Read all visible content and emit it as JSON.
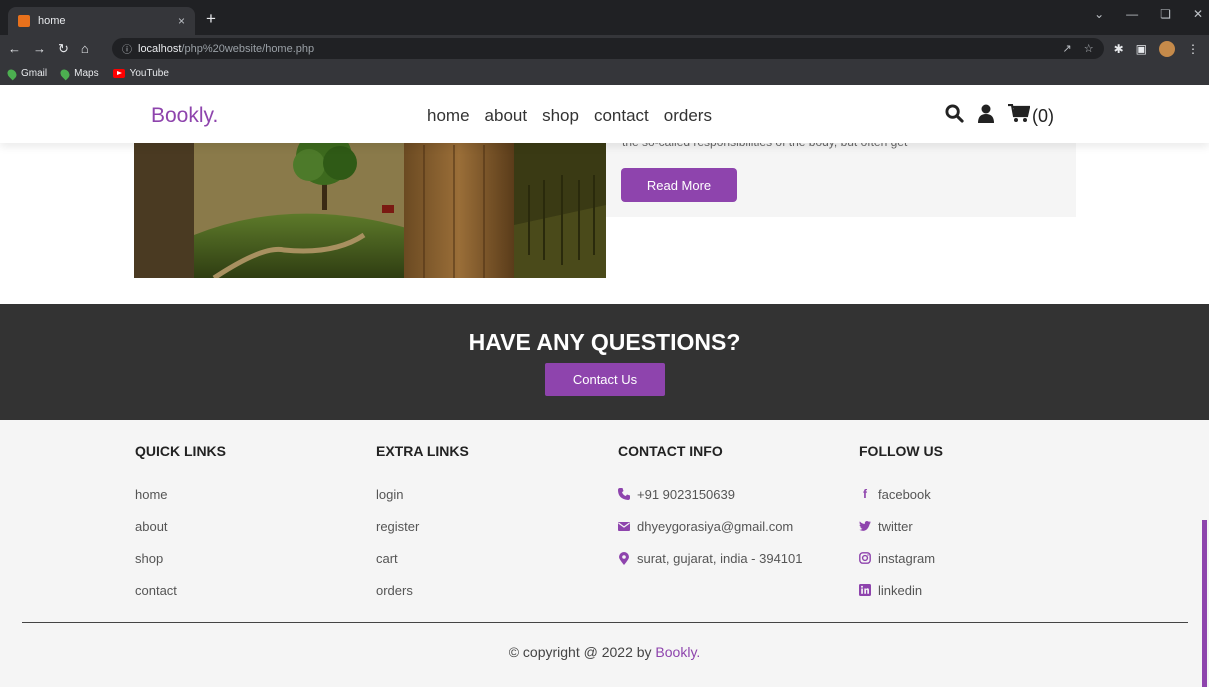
{
  "browser": {
    "tab_title": "home",
    "tab_close": "×",
    "new_tab": "+",
    "url_host": "localhost",
    "url_path": "/php%20website/home.php",
    "bookmarks": [
      "Gmail",
      "Maps",
      "YouTube"
    ]
  },
  "header": {
    "logo": "Bookly.",
    "nav": [
      "home",
      "about",
      "shop",
      "contact",
      "orders"
    ],
    "cart_count": "(0)"
  },
  "about": {
    "text_fragment": "the so-called responsibilities of the body, but often get",
    "button": "Read More"
  },
  "questions": {
    "title": "HAVE ANY QUESTIONS?",
    "button": "Contact Us"
  },
  "footer": {
    "quick_links": {
      "title": "QUICK LINKS",
      "items": [
        "home",
        "about",
        "shop",
        "contact"
      ]
    },
    "extra_links": {
      "title": "EXTRA LINKS",
      "items": [
        "login",
        "register",
        "cart",
        "orders"
      ]
    },
    "contact_info": {
      "title": "CONTACT INFO",
      "phone": "+91 9023150639",
      "email": "dhyeygorasiya@gmail.com",
      "address": "surat, gujarat, india - 394101"
    },
    "follow_us": {
      "title": "FOLLOW US",
      "items": [
        "facebook",
        "twitter",
        "instagram",
        "linkedin"
      ]
    },
    "copyright_prefix": "© copyright @ 2022 by",
    "copyright_brand": "Bookly."
  },
  "colors": {
    "accent": "#8e44ad",
    "dark": "#333333",
    "light_bg": "#f5f5f5"
  },
  "icons": [
    "search-icon",
    "user-icon",
    "cart-icon",
    "phone-icon",
    "envelope-icon",
    "map-marker-icon",
    "facebook-icon",
    "twitter-icon",
    "instagram-icon",
    "linkedin-icon"
  ]
}
